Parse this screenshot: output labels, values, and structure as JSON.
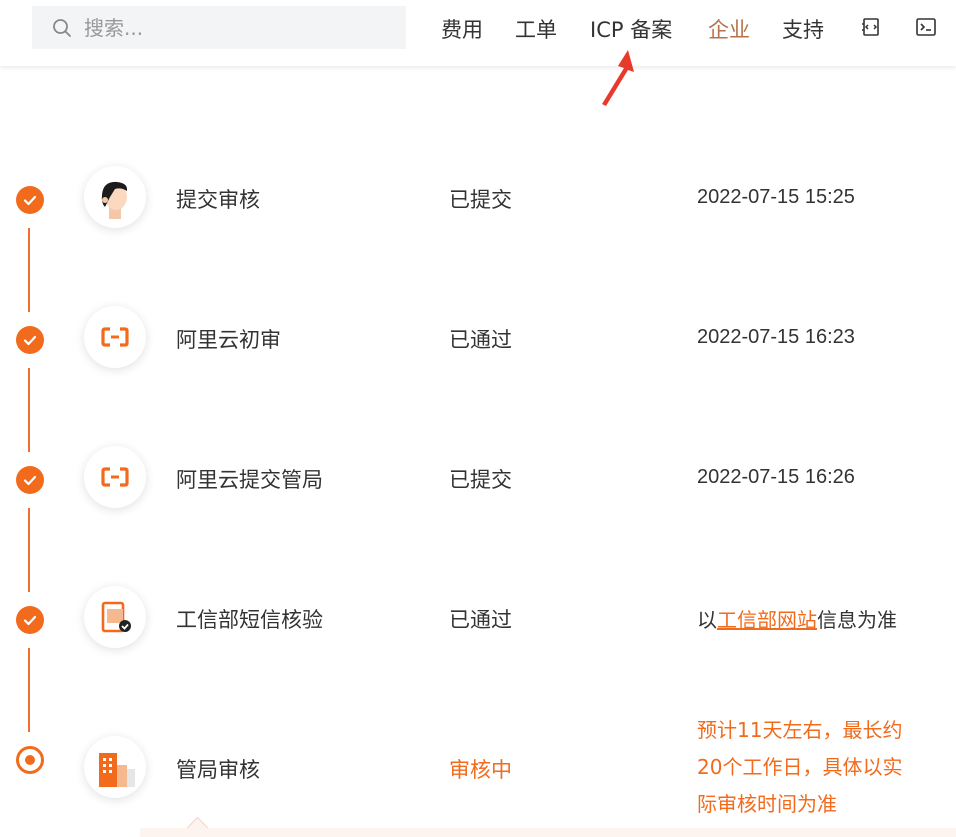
{
  "header": {
    "search_placeholder": "搜索...",
    "nav": [
      "费用",
      "工单",
      "ICP 备案",
      "企业",
      "支持"
    ],
    "active_nav": "企业",
    "icons": [
      "edit-code-icon",
      "terminal-icon"
    ]
  },
  "steps": [
    {
      "label": "提交审核",
      "status": "已提交",
      "time": "2022-07-15 15:25",
      "icon": "user-avatar-icon"
    },
    {
      "label": "阿里云初审",
      "status": "已通过",
      "time": "2022-07-15 16:23",
      "icon": "aliyun-logo-icon"
    },
    {
      "label": "阿里云提交管局",
      "status": "已提交",
      "time": "2022-07-15 16:26",
      "icon": "aliyun-logo-icon"
    },
    {
      "label": "工信部短信核验",
      "status": "已通过",
      "note_prefix": "以",
      "note_link": "工信部网站",
      "note_suffix": "信息为准",
      "icon": "phone-check-icon"
    },
    {
      "label": "管局审核",
      "status": "审核中",
      "note_lines": [
        "预计11天左右，最长约",
        "20个工作日，具体以实",
        "际审核时间为准"
      ],
      "icon": "building-icon"
    }
  ],
  "colors": {
    "accent": "#f26b1d",
    "active_nav": "#b4734a",
    "arrow": "#e8392d"
  }
}
